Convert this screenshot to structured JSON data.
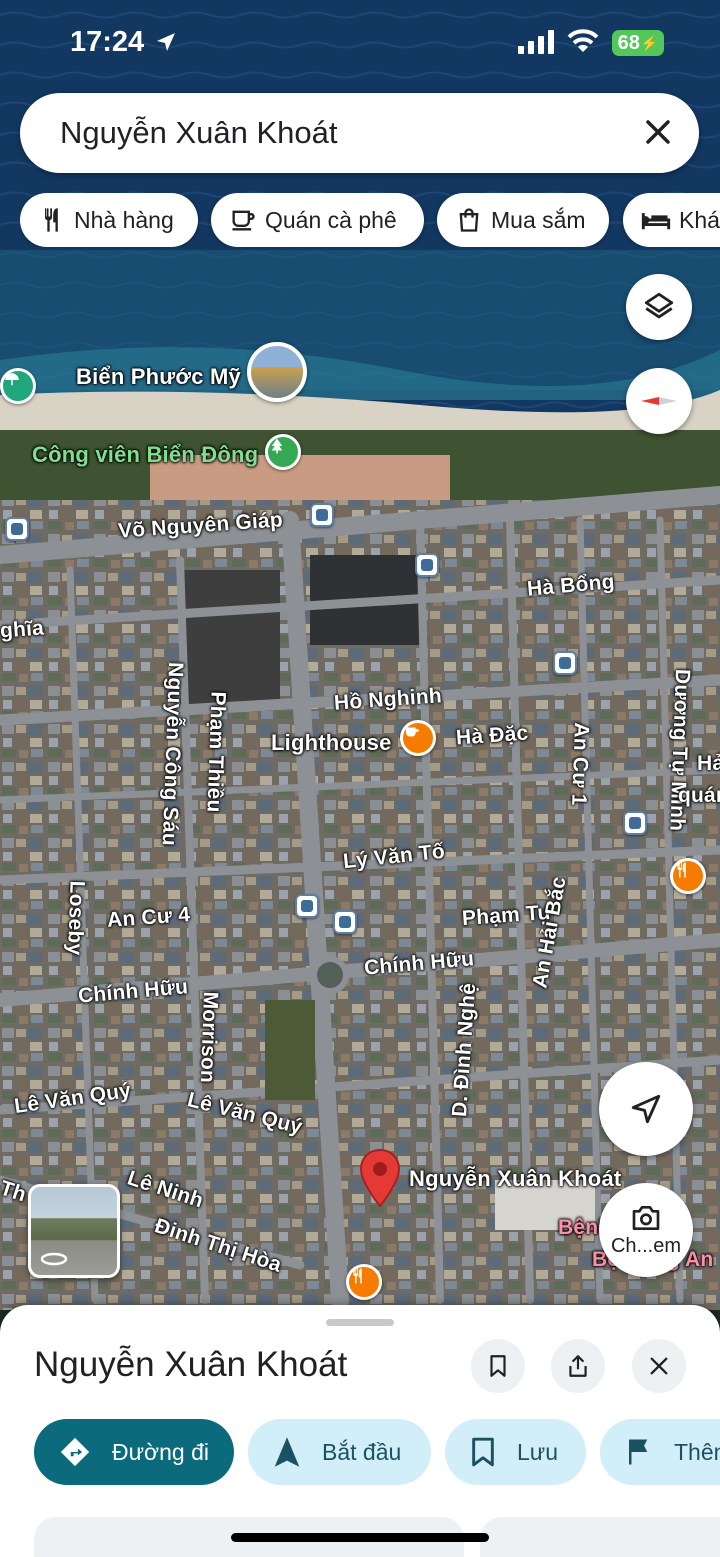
{
  "status_bar": {
    "time": "17:24",
    "battery": "68"
  },
  "search": {
    "query": "Nguyễn Xuân Khoát"
  },
  "chips": [
    {
      "label": "Nhà hàng",
      "icon": "restaurant-icon"
    },
    {
      "label": "Quán cà phê",
      "icon": "coffee-icon"
    },
    {
      "label": "Mua sắm",
      "icon": "shopping-bag-icon"
    },
    {
      "label": "Khác",
      "icon": "bed-icon"
    }
  ],
  "map": {
    "labels": {
      "bien_phuoc_my": "Biển Phước Mỹ",
      "cong_vien": "Công viên Biển Đông",
      "vo_nguyen_giap": "Võ Nguyên Giáp",
      "ha_bong": "Hà Bổng",
      "nghia": "ghĩa",
      "ho_nghinh": "Hồ Nghinh",
      "lighthouse": "Lighthouse",
      "ha_dac": "Hà Đặc",
      "an_cu_1": "An Cư 1",
      "duong_tu_minh": "Dương Tự Minh",
      "ha_partial": "Hả",
      "quan_partial": "quán",
      "nguyen_cong_sau": "Nguyễn Công Sáu",
      "pham_thieu": "Phạm Thiều",
      "ly_van_to": "Lý Văn Tố",
      "pham_tu": "Phạm Tu",
      "an_cu_4": "An Cư 4",
      "loseby": "Loseby",
      "chinh_huu_1": "Chính Hữu",
      "chinh_huu_2": "Chính Hữu",
      "an_hai_bac": "An Hải Bắc",
      "morrison": "Morrison",
      "d_dinh_nghe": "D. Đình Nghệ",
      "le_van_quy_1": "Lê Văn Quý",
      "le_van_quy_2": "Lê Văn Quý",
      "le_ninh": "Lê Ninh",
      "dinh_thi_hoa": "Đinh Thị Hòa",
      "nguyen_xuan_khoat": "Nguyễn Xuân Khoát",
      "benh": "Bệnh",
      "bo_dang_an": "Bộ Đăng An",
      "th_partial": "Th"
    },
    "camera_button_label": "Ch...em"
  },
  "sheet": {
    "title": "Nguyễn Xuân Khoát",
    "actions": [
      {
        "label": "Đường đi",
        "icon": "directions-icon"
      },
      {
        "label": "Bắt đầu",
        "icon": "navigation-arrow-icon"
      },
      {
        "label": "Lưu",
        "icon": "bookmark-icon"
      },
      {
        "label": "Thêm",
        "icon": "flag-icon"
      }
    ]
  },
  "colors": {
    "sea": "#0f2f57",
    "beach": "#d8d3c4",
    "pin_red": "#e53935",
    "food_orange": "#f57c00",
    "park_green": "#34a853",
    "primary_action": "#0b6b7c",
    "secondary_action": "#d2eef8"
  }
}
